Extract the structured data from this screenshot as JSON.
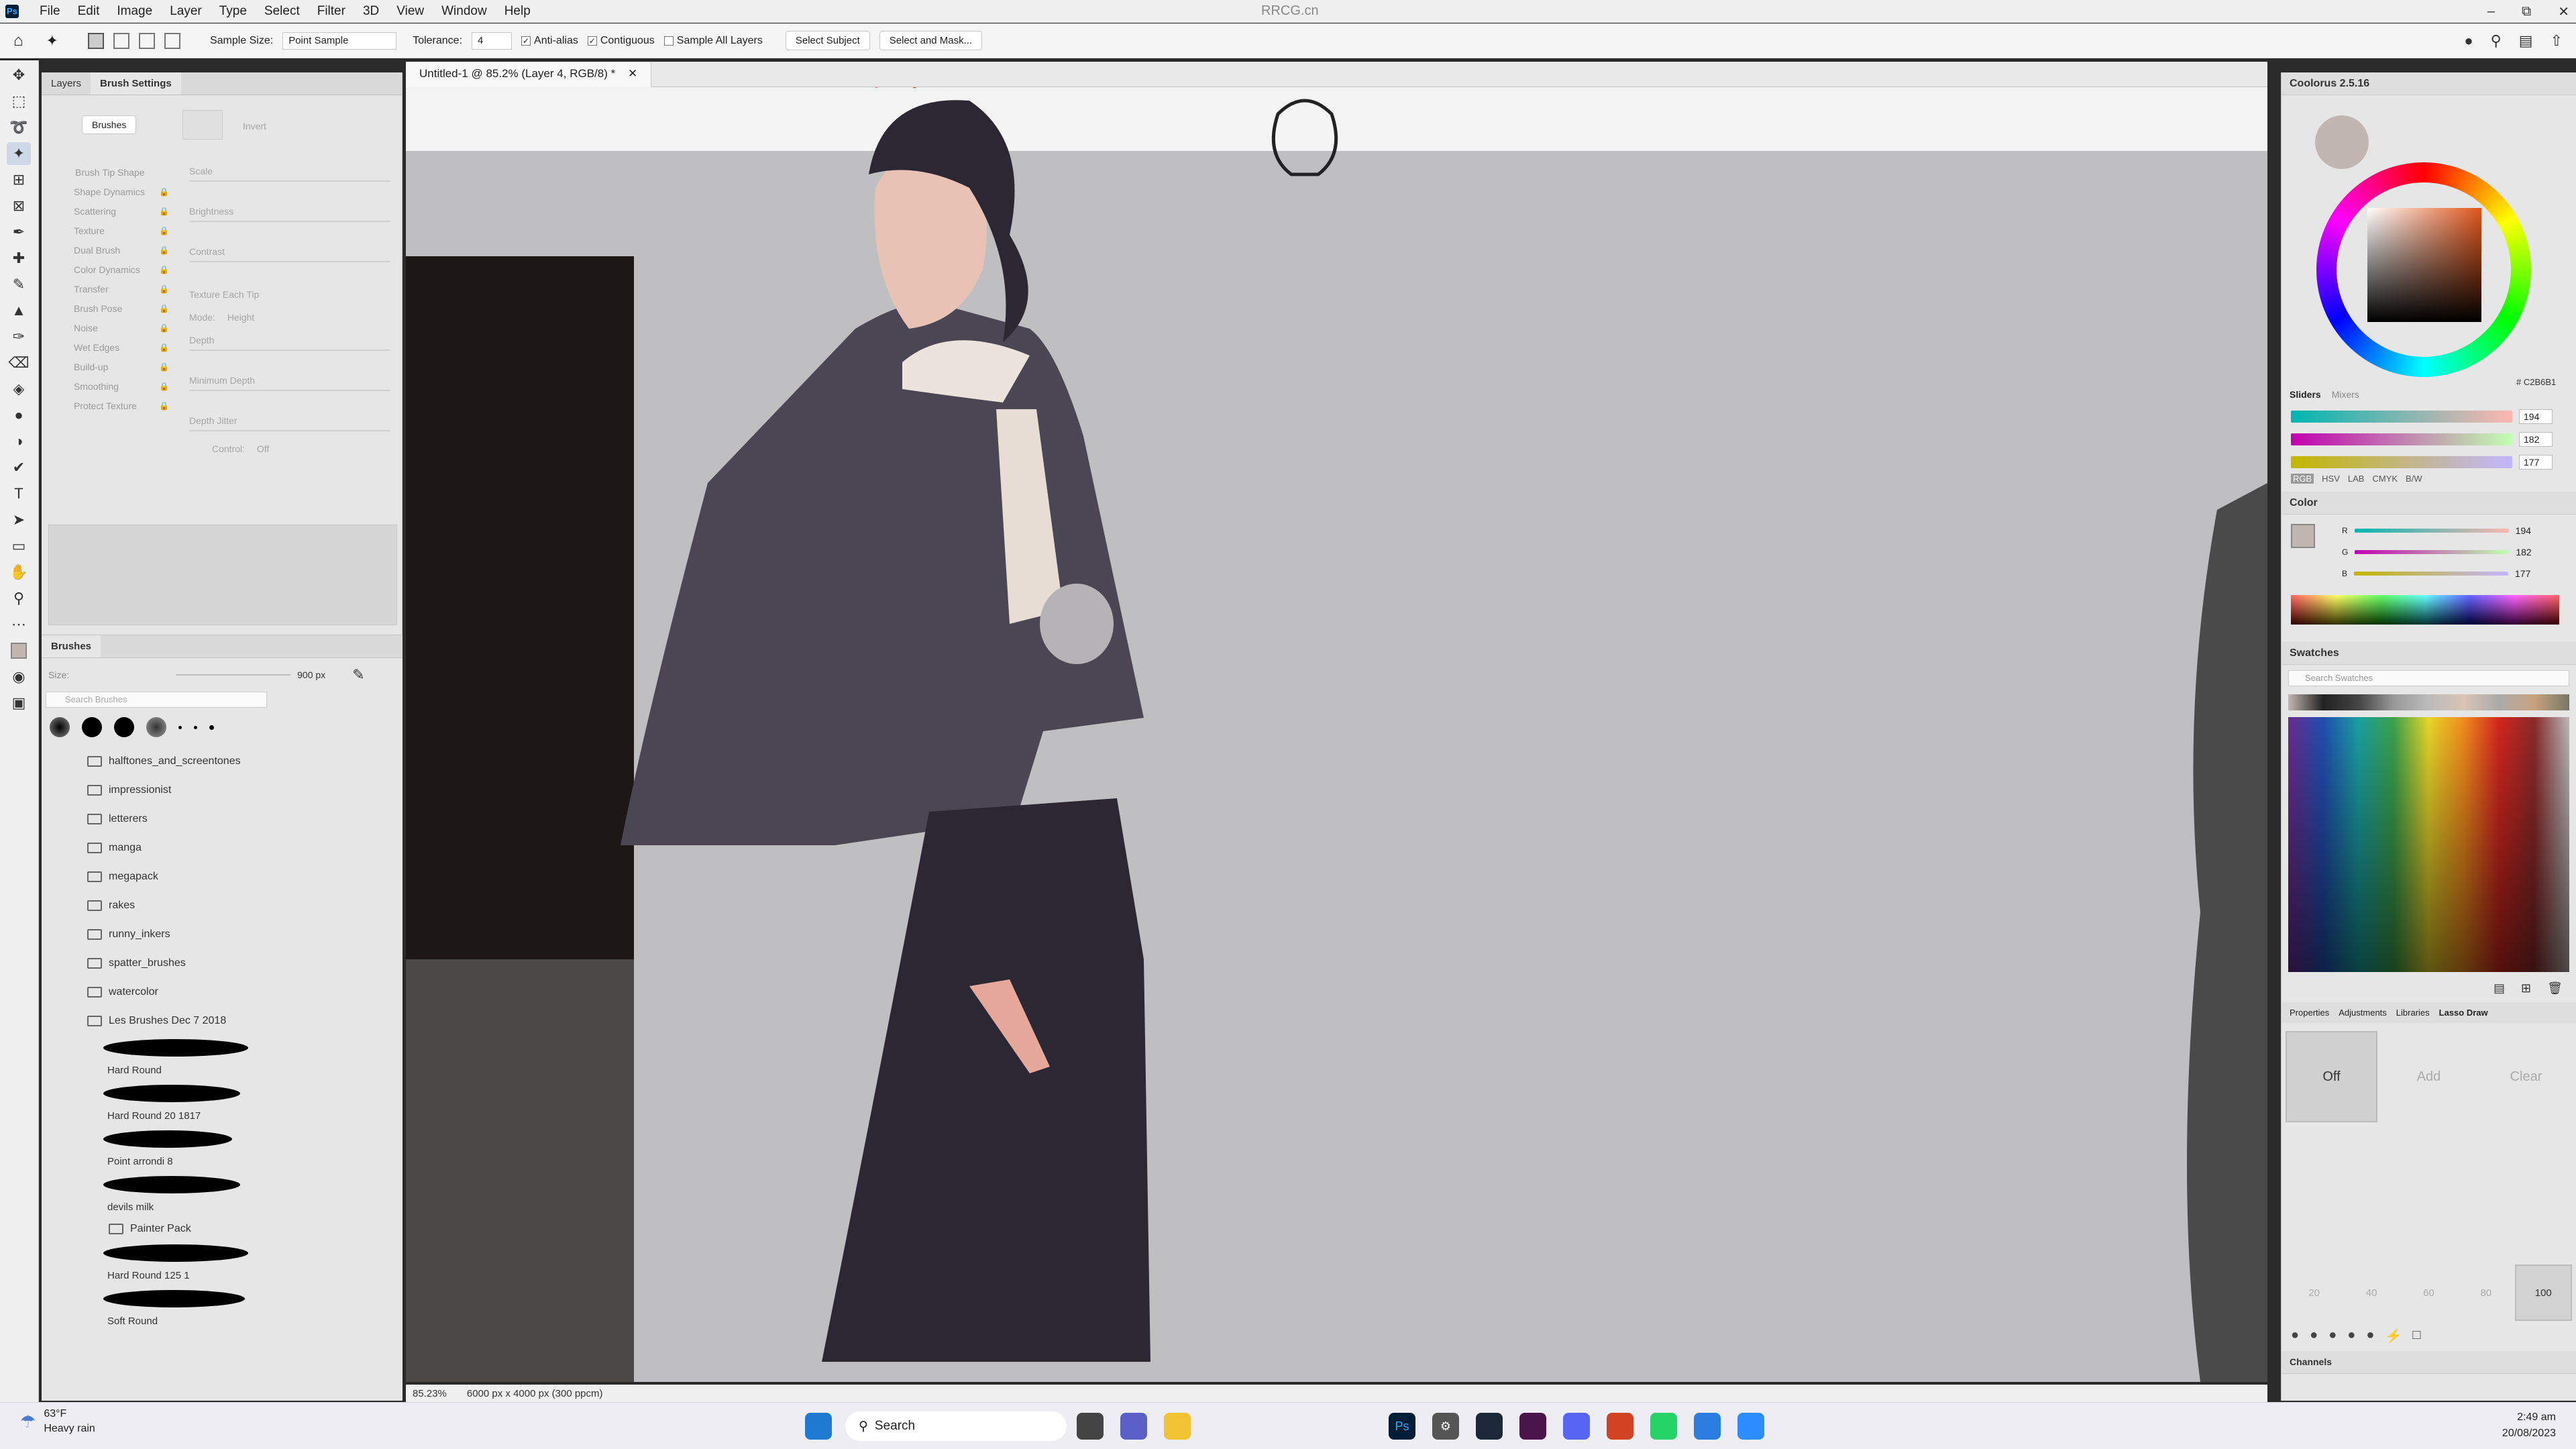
{
  "menubar": {
    "items": [
      "File",
      "Edit",
      "Image",
      "Layer",
      "Type",
      "Select",
      "Filter",
      "3D",
      "View",
      "Window",
      "Help"
    ],
    "watermark": "RRCG.cn"
  },
  "options": {
    "sample_size_label": "Sample Size:",
    "sample_size_value": "Point Sample",
    "tolerance_label": "Tolerance:",
    "tolerance_value": "4",
    "anti_alias": "Anti-alias",
    "contiguous": "Contiguous",
    "sample_all_layers": "Sample All Layers",
    "select_subject": "Select Subject",
    "select_and_mask": "Select and Mask..."
  },
  "left_panel": {
    "tabs": [
      "Layers",
      "Brush Settings"
    ],
    "brushes_button": "Brushes",
    "invert_label": "Invert",
    "settings_items": [
      "Brush Tip Shape",
      "Shape Dynamics",
      "Scattering",
      "Texture",
      "Dual Brush",
      "Color Dynamics",
      "Transfer",
      "Brush Pose",
      "Noise",
      "Wet Edges",
      "Build-up",
      "Smoothing",
      "Protect Texture"
    ],
    "texture_controls": {
      "scale": "Scale",
      "brightness": "Brightness",
      "contrast": "Contrast",
      "texture_each_tip": "Texture Each Tip",
      "mode_label": "Mode:",
      "mode_value": "Height",
      "depth": "Depth",
      "minimum_depth": "Minimum Depth",
      "depth_jitter": "Depth Jitter",
      "control_label": "Control:",
      "control_value": "Off"
    }
  },
  "brushes_panel": {
    "title": "Brushes",
    "size_label": "Size:",
    "size_value": "900 px",
    "search_placeholder": "Search Brushes",
    "folders": [
      "halftones_and_screentones",
      "impressionist",
      "letterers",
      "manga",
      "megapack",
      "rakes",
      "runny_inkers",
      "spatter_brushes",
      "watercolor",
      "Les Brushes Dec 7 2018"
    ],
    "brushes": [
      {
        "name": "Hard Round",
        "w": 0.9
      },
      {
        "name": "Hard Round 20 1817",
        "w": 0.85
      },
      {
        "name": "Point arrondi 8",
        "w": 0.8
      },
      {
        "name": "devils milk",
        "w": 0.85
      }
    ],
    "subfolder": "Painter Pack",
    "brushes2": [
      {
        "name": "Hard Round 125 1",
        "w": 0.9
      },
      {
        "name": "Soft Round",
        "w": 0.88
      }
    ]
  },
  "document": {
    "tab_title": "Untitled-1 @ 85.2% (Layer 4, RGB/8) *",
    "zoom": "85.23%",
    "doc_size": "6000 px x 4000 px (300 ppcm)"
  },
  "coolorus": {
    "title": "Coolorus 2.5.16",
    "hex": "# C2B6B1",
    "tabs": [
      "Sliders",
      "Mixers"
    ],
    "values": [
      "194",
      "182",
      "177"
    ],
    "modes": [
      "RGB",
      "HSV",
      "LAB",
      "CMYK",
      "B/W"
    ]
  },
  "color_panel": {
    "title": "Color",
    "labels": [
      "R",
      "G",
      "B"
    ],
    "values": [
      "194",
      "182",
      "177"
    ]
  },
  "swatches": {
    "title": "Swatches",
    "search_placeholder": "Search Swatches"
  },
  "lasso_panel": {
    "tabs": [
      "Properties",
      "Adjustments",
      "Libraries",
      "Lasso Draw"
    ],
    "buttons": [
      "Off",
      "Add",
      "Clear"
    ],
    "percents": [
      "20",
      "40",
      "60",
      "80",
      "100"
    ],
    "channels": "Channels"
  },
  "taskbar": {
    "weather_temp": "63°F",
    "weather_desc": "Heavy rain",
    "search_label": "Search",
    "time": "2:49 am",
    "date": "20/08/2023"
  },
  "colors": {
    "current": "#C2B6B1",
    "canvas_bg": "#bfbfc2",
    "dress": "#2b2834",
    "cape": "#4a4654"
  }
}
